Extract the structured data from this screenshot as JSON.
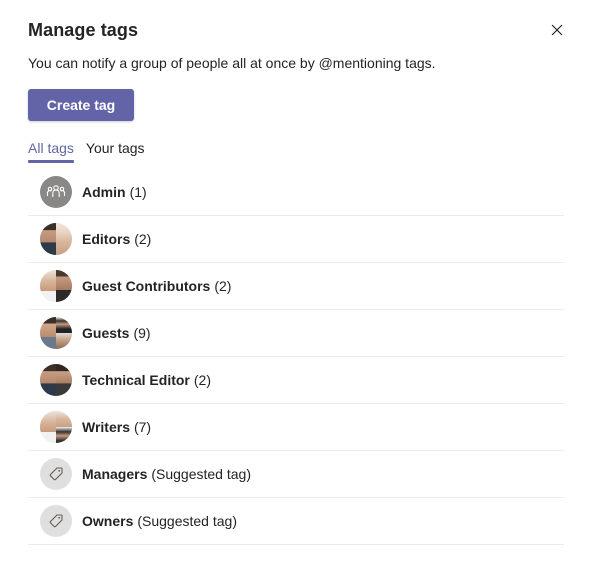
{
  "dialog": {
    "title": "Manage tags",
    "subtitle": "You can notify a group of people all at once by @mentioning tags.",
    "close_icon": "close-icon",
    "create_button_label": "Create tag",
    "accent_color": "#6264a7"
  },
  "tabs": [
    {
      "label": "All tags",
      "active": true
    },
    {
      "label": "Your tags",
      "active": false
    }
  ],
  "tags": [
    {
      "name": "Admin",
      "count": "(1)",
      "avatar": "group-icon"
    },
    {
      "name": "Editors",
      "count": "(2)",
      "avatar": "member-photos"
    },
    {
      "name": "Guest Contributors",
      "count": "(2)",
      "avatar": "member-photos"
    },
    {
      "name": "Guests",
      "count": "(9)",
      "avatar": "member-photos"
    },
    {
      "name": "Technical Editor",
      "count": "(2)",
      "avatar": "member-photos"
    },
    {
      "name": "Writers",
      "count": "(7)",
      "avatar": "member-photos"
    },
    {
      "name": "Managers",
      "count": "(Suggested tag)",
      "avatar": "tag-icon"
    },
    {
      "name": "Owners",
      "count": "(Suggested tag)",
      "avatar": "tag-icon"
    }
  ]
}
